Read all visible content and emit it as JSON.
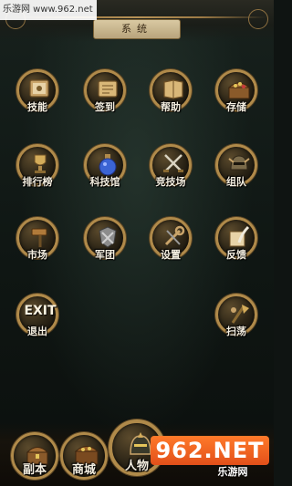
{
  "watermark_top": "乐游网 www.962.net",
  "header": {
    "title": "系统"
  },
  "grid": [
    {
      "name": "skills",
      "label": "技能",
      "icon": "skill-book-icon"
    },
    {
      "name": "signin",
      "label": "签到",
      "icon": "scroll-icon"
    },
    {
      "name": "help",
      "label": "帮助",
      "icon": "help-book-icon"
    },
    {
      "name": "storage",
      "label": "存储",
      "icon": "treasure-chest-icon"
    },
    {
      "name": "ranking",
      "label": "排行榜",
      "icon": "trophy-icon"
    },
    {
      "name": "tech",
      "label": "科技馆",
      "icon": "potion-icon"
    },
    {
      "name": "arena",
      "label": "竞技场",
      "icon": "crossed-swords-icon"
    },
    {
      "name": "team",
      "label": "组队",
      "icon": "helmet-icon"
    },
    {
      "name": "market",
      "label": "市场",
      "icon": "hammer-icon"
    },
    {
      "name": "guild",
      "label": "军团",
      "icon": "guild-emblem-icon"
    },
    {
      "name": "settings",
      "label": "设置",
      "icon": "wrench-icon"
    },
    {
      "name": "feedback",
      "label": "反馈",
      "icon": "quill-icon"
    },
    {
      "name": "exit",
      "label": "退出",
      "exit_text": "EXIT",
      "icon": "exit-icon"
    },
    {
      "name": "sweep",
      "label": "扫荡",
      "icon": "sweep-icon"
    }
  ],
  "bottom_nav": [
    {
      "name": "dungeon",
      "label": "副本",
      "icon": "dungeon-chest-icon"
    },
    {
      "name": "shop",
      "label": "商城",
      "icon": "shop-chest-icon"
    },
    {
      "name": "character",
      "label": "人物",
      "icon": "character-helmet-icon"
    }
  ],
  "watermark_bottom": {
    "logo": "962.NET",
    "sub": "乐游网"
  },
  "colors": {
    "gold": "#b08a4a",
    "label": "#f4eee0",
    "bg": "#0f1613"
  }
}
